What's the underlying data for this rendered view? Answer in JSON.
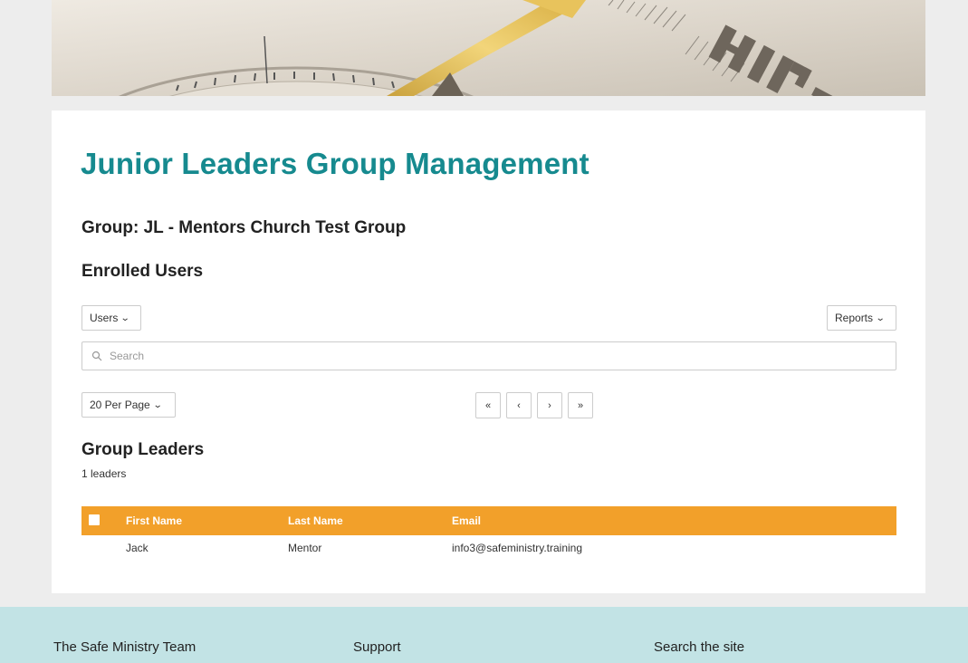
{
  "page": {
    "title": "Junior Leaders Group Management",
    "group_heading": "Group: JL - Mentors Church Test Group",
    "enrolled_heading": "Enrolled Users"
  },
  "toolbar": {
    "users_label": "Users",
    "reports_label": "Reports",
    "search_placeholder": "Search",
    "per_page_label": "20 Per Page"
  },
  "pagination": {
    "first": "«",
    "prev": "‹",
    "next": "›",
    "last": "»"
  },
  "leaders": {
    "heading": "Group Leaders",
    "count_text": "1 leaders",
    "columns": [
      "First Name",
      "Last Name",
      "Email"
    ],
    "rows": [
      {
        "first_name": "Jack",
        "last_name": "Mentor",
        "email": "info3@safeministry.training"
      }
    ]
  },
  "footer": {
    "col1": "The Safe Ministry Team",
    "col2": "Support",
    "col3": "Search the site"
  },
  "colors": {
    "title_teal": "#168a8f",
    "table_header_orange": "#f2a02a",
    "footer_bg": "#c2e3e5",
    "page_bg": "#ededed"
  },
  "icons": {
    "search": "search-icon",
    "chevron": "chevron-down-icon",
    "checkbox": "select-all-checkbox"
  }
}
